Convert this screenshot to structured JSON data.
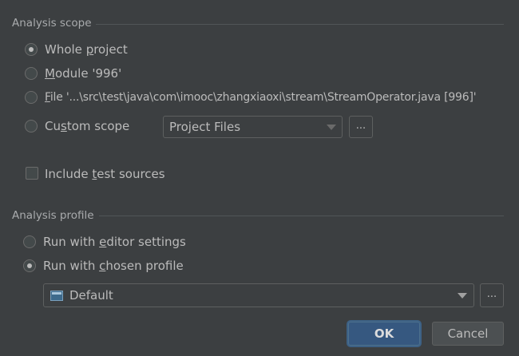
{
  "analysis_scope": {
    "title": "Analysis scope",
    "options": [
      {
        "pre": "Whole ",
        "mn": "p",
        "post": "roject",
        "checked": true
      },
      {
        "pre": "",
        "mn": "M",
        "post": "odule '996'",
        "checked": false
      },
      {
        "pre": "",
        "mn": "F",
        "post": "ile '...\\src\\test\\java\\com\\imooc\\zhangxiaoxi\\stream\\StreamOperator.java [996]'",
        "checked": false
      },
      {
        "pre": "Cu",
        "mn": "s",
        "post": "tom scope",
        "checked": false
      }
    ],
    "custom_scope_value": "Project Files",
    "ellipsis": "...",
    "include_tests": {
      "pre": "Include ",
      "mn": "t",
      "post": "est sources",
      "checked": false
    }
  },
  "analysis_profile": {
    "title": "Analysis profile",
    "options": [
      {
        "pre": "Run with ",
        "mn": "e",
        "post": "ditor settings",
        "checked": false
      },
      {
        "pre": "Run with ",
        "mn": "c",
        "post": "hosen profile",
        "checked": true
      }
    ],
    "profile_value": "Default",
    "ellipsis": "..."
  },
  "buttons": {
    "ok": "OK",
    "cancel": "Cancel"
  },
  "icons": {
    "profile": "profile-icon",
    "dropdown": "chevron-down-icon"
  },
  "colors": {
    "background": "#3c3f41",
    "text": "#bbbbbb",
    "ok_button": "#365880"
  }
}
